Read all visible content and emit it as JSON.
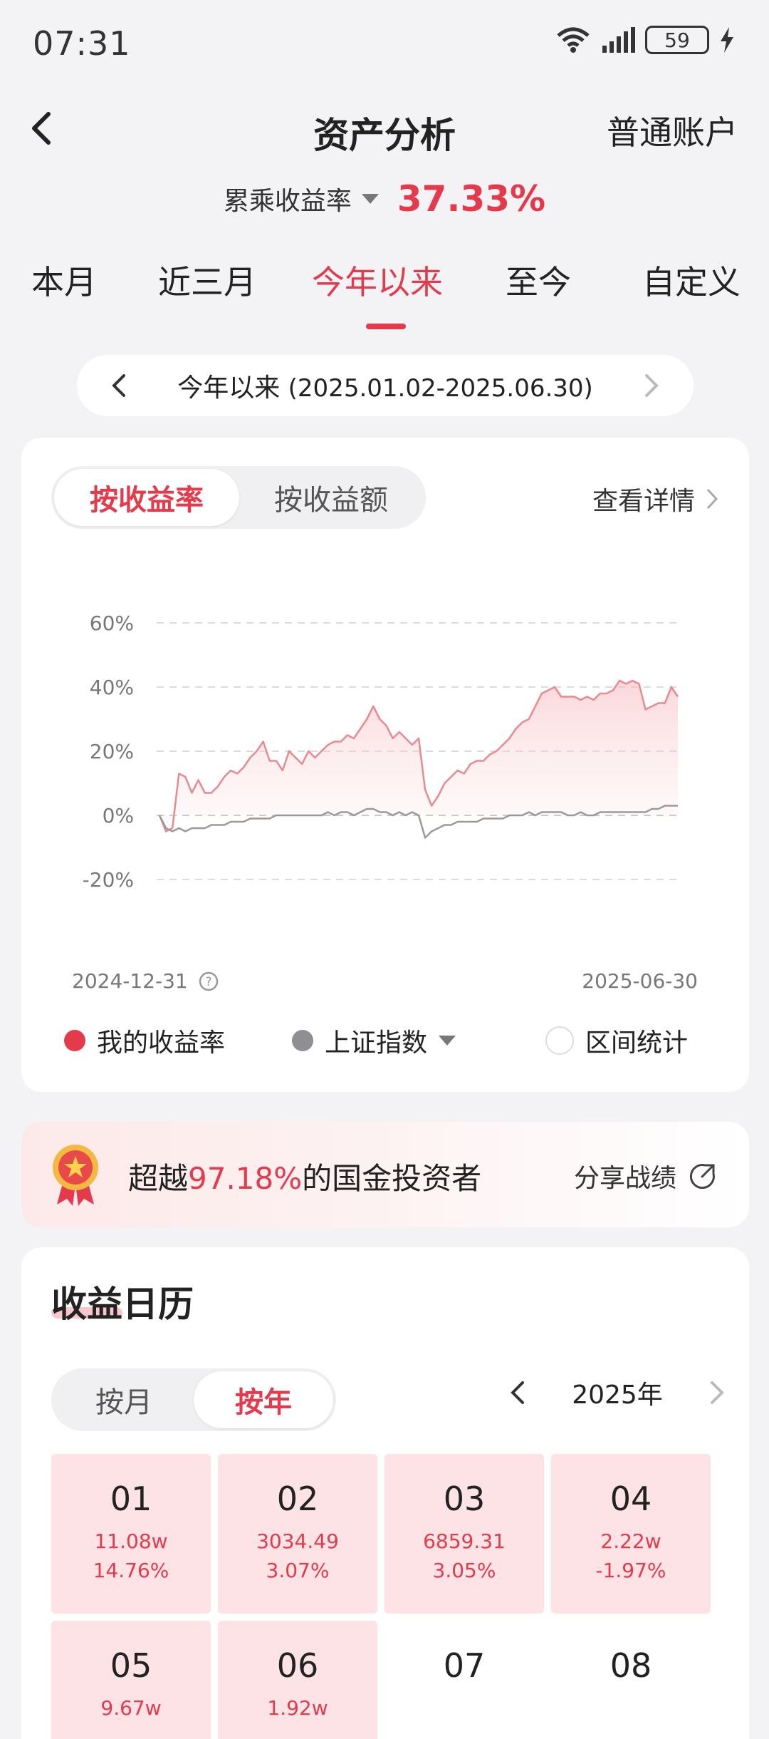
{
  "status_bar": {
    "time": "07:31",
    "battery": "59"
  },
  "header": {
    "title": "资产分析",
    "account": "普通账户"
  },
  "cumulative": {
    "label": "累乘收益率",
    "value": "37.33%"
  },
  "period_tabs": [
    {
      "label": "本月",
      "active": false
    },
    {
      "label": "近三月",
      "active": false
    },
    {
      "label": "今年以来",
      "active": true
    },
    {
      "label": "至今",
      "active": false
    },
    {
      "label": "自定义",
      "active": false
    }
  ],
  "range": {
    "label": "今年以来",
    "dates": "(2025.01.02-2025.06.30)"
  },
  "chart_card": {
    "segments": [
      {
        "label": "按收益率",
        "active": true
      },
      {
        "label": "按收益额",
        "active": false
      }
    ],
    "view_detail": "查看详情",
    "start_date": "2024-12-31",
    "end_date": "2025-06-30",
    "legend": {
      "mine": "我的收益率",
      "index": "上证指数",
      "interval": "区间统计"
    }
  },
  "chart_data": {
    "type": "line",
    "x_range": [
      "2024-12-31",
      "2025-06-30"
    ],
    "y_ticks": [
      "60%",
      "40%",
      "20%",
      "0%",
      "-20%"
    ],
    "ylim": [
      -20,
      60
    ],
    "grid": true,
    "series": [
      {
        "name": "我的收益率",
        "color": "#e88a8f",
        "fill": true,
        "values": [
          0,
          -5,
          -4,
          13,
          12,
          7,
          11,
          7,
          7,
          9,
          12,
          14,
          13,
          15,
          18,
          20,
          23,
          17,
          17,
          14,
          20,
          18,
          16,
          20,
          18,
          20,
          22,
          23,
          23,
          25,
          24,
          27,
          30,
          34,
          30,
          28,
          24,
          26,
          24,
          22,
          24,
          8,
          3,
          6,
          10,
          12,
          14,
          13,
          16,
          17,
          17,
          19,
          20,
          22,
          24,
          27,
          29,
          30,
          34,
          38,
          39,
          40,
          37,
          37,
          37,
          36,
          37,
          36,
          38,
          38,
          39,
          42,
          41,
          42,
          41,
          33,
          34,
          35,
          35,
          40,
          37
        ]
      },
      {
        "name": "上证指数",
        "color": "#9a9a9a",
        "fill": false,
        "values": [
          0,
          -4,
          -5,
          -4,
          -5,
          -4,
          -4,
          -4,
          -3,
          -3,
          -3,
          -2,
          -2,
          -2,
          -1,
          -1,
          -1,
          -1,
          0,
          0,
          0,
          0,
          0,
          0,
          0,
          0,
          1,
          0,
          1,
          1,
          0,
          1,
          2,
          2,
          1,
          1,
          0,
          1,
          0,
          1,
          0,
          -7,
          -5,
          -4,
          -3,
          -3,
          -2,
          -2,
          -2,
          -2,
          -1,
          -1,
          -1,
          -1,
          0,
          0,
          0,
          1,
          0,
          1,
          1,
          1,
          1,
          0,
          0,
          1,
          0,
          0,
          1,
          1,
          1,
          1,
          1,
          1,
          1,
          1,
          2,
          2,
          3,
          3,
          3
        ]
      }
    ]
  },
  "beat_banner": {
    "prefix": "超越",
    "percent": "97.18%",
    "suffix": "的国金投资者",
    "share": "分享战绩"
  },
  "calendar": {
    "title": "收益日历",
    "segments": [
      {
        "label": "按月",
        "active": false
      },
      {
        "label": "按年",
        "active": true
      }
    ],
    "year": "2025年",
    "months": [
      {
        "num": "01",
        "amount": "11.08w",
        "pct": "14.76%",
        "filled": true
      },
      {
        "num": "02",
        "amount": "3034.49",
        "pct": "3.07%",
        "filled": true
      },
      {
        "num": "03",
        "amount": "6859.31",
        "pct": "3.05%",
        "filled": true
      },
      {
        "num": "04",
        "amount": "2.22w",
        "pct": "-1.97%",
        "filled": true
      },
      {
        "num": "05",
        "amount": "9.67w",
        "pct": "",
        "filled": true
      },
      {
        "num": "06",
        "amount": "1.92w",
        "pct": "",
        "filled": true
      },
      {
        "num": "07",
        "amount": "",
        "pct": "",
        "filled": false
      },
      {
        "num": "08",
        "amount": "",
        "pct": "",
        "filled": false
      }
    ]
  },
  "colors": {
    "accent": "#e53a4b",
    "chart_line": "#e88a8f",
    "index_line": "#9a9a9a"
  }
}
